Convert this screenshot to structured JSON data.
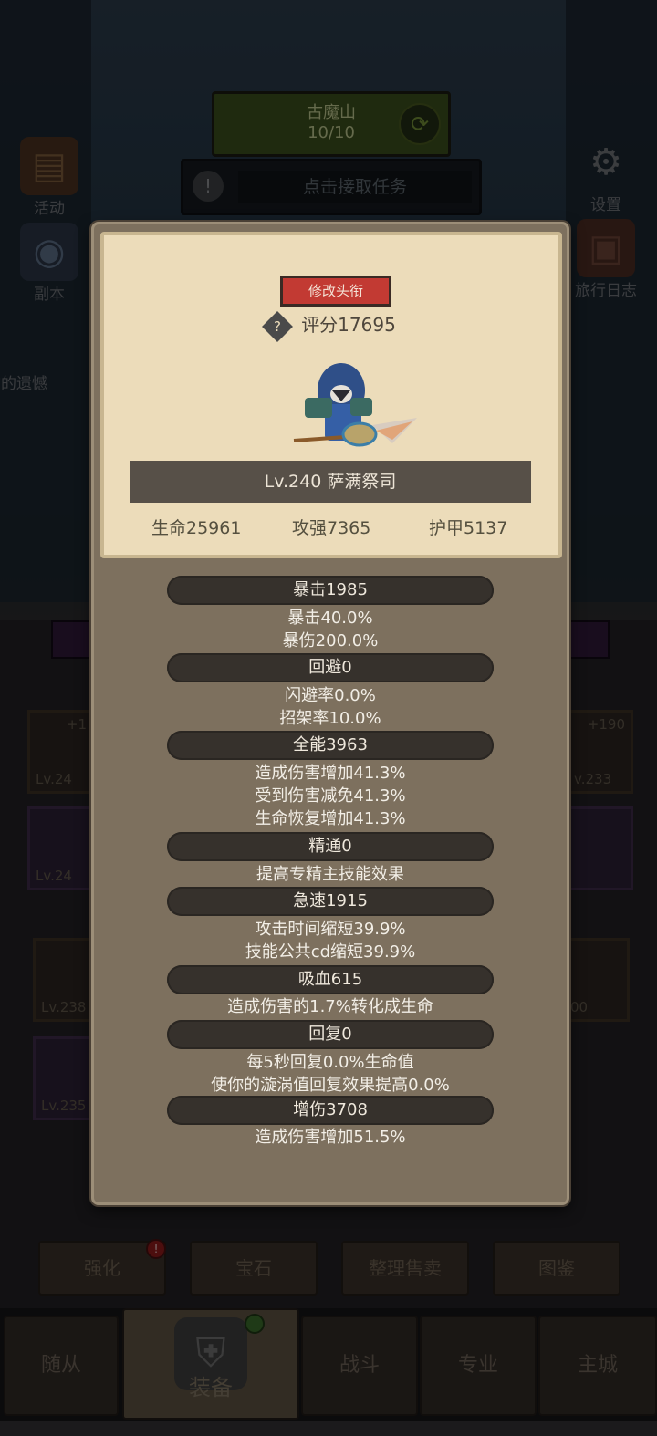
{
  "map": {
    "name": "古魔山",
    "progress": "10/10"
  },
  "quest": {
    "text": "点击接取任务"
  },
  "left_menu": [
    {
      "label": "活动"
    },
    {
      "label": "副本"
    },
    {
      "label": "前的遗憾"
    }
  ],
  "right_menu": [
    {
      "label": "设置"
    },
    {
      "label": "旅行日志"
    }
  ],
  "popup": {
    "rename_label": "修改头衔",
    "score": "评分17695",
    "hero_name": "Lv.240 萨满祭司",
    "hp": "生命25961",
    "attack": "攻强7365",
    "armor": "护甲5137",
    "attributes": [
      {
        "title": "暴击1985",
        "lines": [
          "暴击40.0%",
          "暴伤200.0%"
        ]
      },
      {
        "title": "回避0",
        "lines": [
          "闪避率0.0%",
          "招架率10.0%"
        ]
      },
      {
        "title": "全能3963",
        "lines": [
          "造成伤害增加41.3%",
          "受到伤害减免41.3%",
          "生命恢复增加41.3%"
        ]
      },
      {
        "title": "精通0",
        "lines": [
          "提高专精主技能效果"
        ]
      },
      {
        "title": "急速1915",
        "lines": [
          "攻击时间缩短39.9%",
          "技能公共cd缩短39.9%"
        ]
      },
      {
        "title": "吸血615",
        "lines": [
          "造成伤害的1.7%转化成生命"
        ]
      },
      {
        "title": "回复0",
        "lines": [
          "每5秒回复0.0%生命值",
          "使你的漩涡值回复效果提高0.0%"
        ]
      },
      {
        "title": "增伤3708",
        "lines": [
          "造成伤害增加51.5%"
        ]
      }
    ]
  },
  "slots": {
    "left": [
      {
        "plus": "+1",
        "lv": "Lv.24"
      },
      {
        "lv": "Lv.24"
      }
    ],
    "right": [
      {
        "plus": "+190",
        "lv": "v.233"
      }
    ],
    "lower_left": [
      {
        "lv": "Lv.238"
      },
      {
        "lv": "Lv.235"
      }
    ],
    "lower_right": [
      {
        "lv": "00"
      }
    ]
  },
  "subtabs": [
    "强化",
    "宝石",
    "整理售卖",
    "图鉴"
  ],
  "nav": [
    "随从",
    "装备",
    "战斗",
    "专业",
    "主城"
  ]
}
